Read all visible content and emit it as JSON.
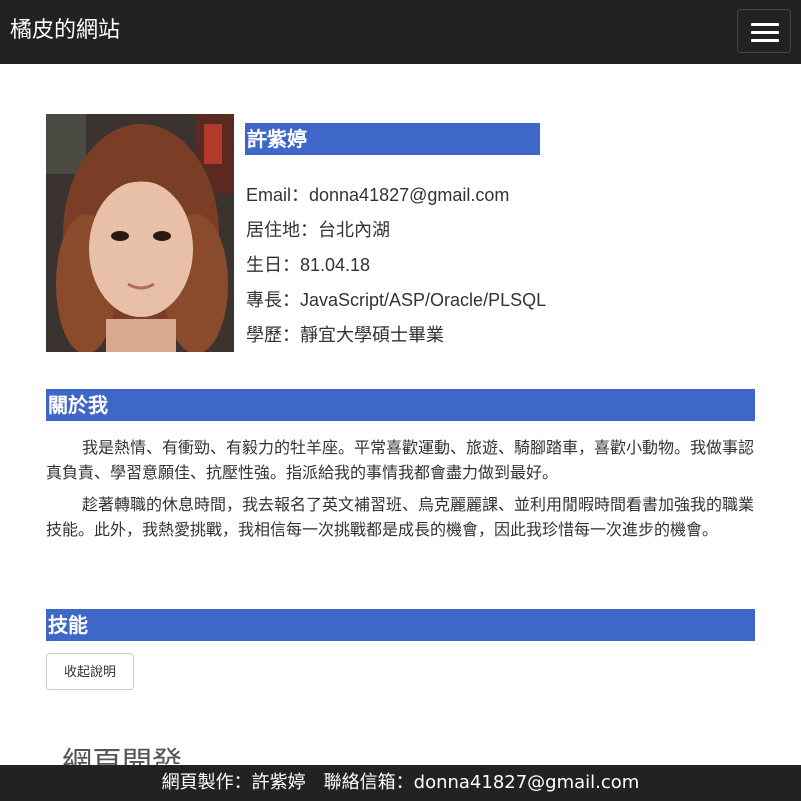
{
  "navbar": {
    "brand": "橘皮的網站",
    "menu_icon": "hamburger-menu-icon"
  },
  "profile": {
    "photo_description": "portrait-photo",
    "name": "許紫婷",
    "info": [
      "Email：donna41827@gmail.com",
      "居住地：台北內湖",
      "生日：81.04.18",
      "專長：JavaScript/ASP/Oracle/PLSQL",
      "學歷：靜宜大學碩士畢業"
    ]
  },
  "about": {
    "heading": "關於我",
    "paragraphs": [
      "我是熱情、有衝勁、有毅力的牡羊座。平常喜歡運動、旅遊、騎腳踏車，喜歡小動物。我做事認真負責、學習意願佳、抗壓性強。指派給我的事情我都會盡力做到最好。",
      "趁著轉職的休息時間，我去報名了英文補習班、烏克麗麗課、並利用閒暇時間看書加強我的職業技能。此外，我熱愛挑戰，我相信每一次挑戰都是成長的機會，因此我珍惜每一次進步的機會。"
    ]
  },
  "skills": {
    "heading": "技能",
    "collapse_button": "收起說明",
    "first_item_partial": "網頁開發"
  },
  "footer": {
    "author": "網頁製作：許紫婷",
    "contact": "聯絡信箱：donna41827@gmail.com"
  },
  "colors": {
    "navbar_bg": "#222222",
    "heading_bar": "#3f67c9",
    "text": "#333333"
  }
}
